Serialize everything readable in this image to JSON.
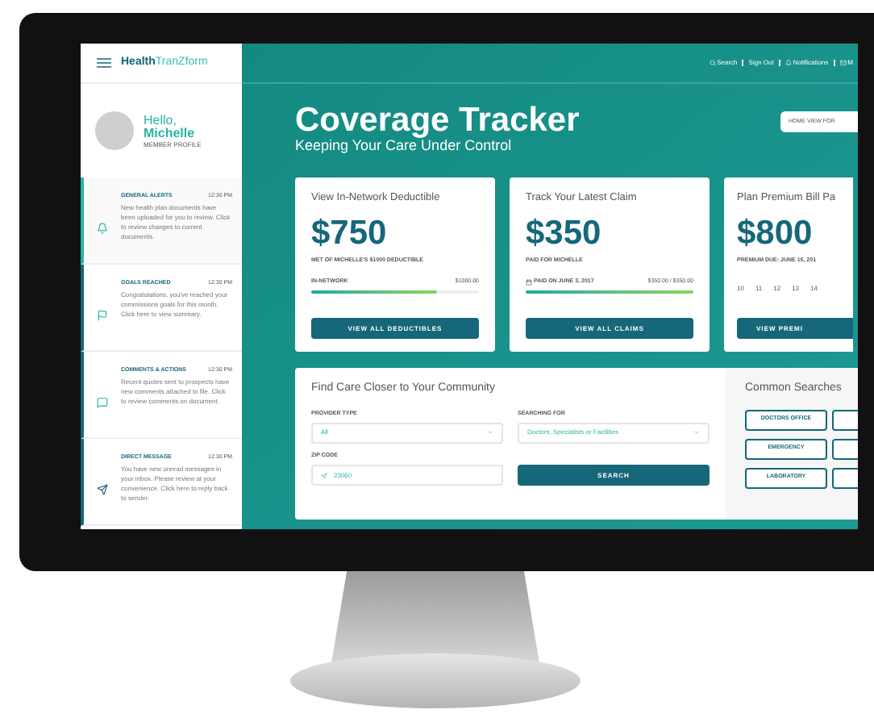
{
  "brand": {
    "part_1": "Health",
    "part_2": "TranZform"
  },
  "profile": {
    "greeting": "Hello,",
    "name": "Michelle",
    "caption": "MEMBER PROFILE"
  },
  "alerts": [
    {
      "kind": "bell",
      "title": "GENERAL ALERTS",
      "time": "12:30 PM",
      "text": "New health plan documents have been uploaded for you to review. Click to review changes to current documents.",
      "selected": true
    },
    {
      "kind": "flag",
      "title": "GOALS REACHED",
      "time": "12:30 PM",
      "text": "Congratulations, you've reached your commissions goals for this month. Click here to view summary.",
      "selected": false
    },
    {
      "kind": "chat",
      "title": "COMMENTS & ACTIONS",
      "time": "12:30 PM",
      "text": "Recent quotes sent to prospects have new comments attached to file. Click to review comments on document.",
      "selected": false
    },
    {
      "kind": "send",
      "title": "DIRECT MESSAGE",
      "time": "12:30 PM",
      "text": "You have new unread messages in your inbox. Please review at your convenience. Click here to reply back to sender.",
      "selected": false
    }
  ],
  "top_nav": [
    {
      "kind": "search",
      "label": "Search"
    },
    {
      "kind": "plain",
      "label": "Sign Out"
    },
    {
      "kind": "bell",
      "label": "Notifications"
    },
    {
      "kind": "mail",
      "label": "M"
    }
  ],
  "header": {
    "title": "Coverage Tracker",
    "subtitle": "Keeping Your Care Under Control",
    "view_select": "HOME VIEW FOR"
  },
  "cards": [
    {
      "kind": "progress",
      "title": "View In-Network Deductible",
      "amount": "$750",
      "caption": "MET OF MICHELLE'S $1000 DEDUCTIBLE",
      "left": "IN-NETWORK",
      "right": "$1000.00",
      "level": 0.75,
      "button": "VIEW ALL DEDUCTIBLES"
    },
    {
      "kind": "progress",
      "title": "Track Your Latest Claim",
      "amount": "$350",
      "caption": "PAID FOR MICHELLE",
      "left": "PAID ON JUNE 3, 2017",
      "right": "$350.00 / $350.00",
      "level": 1,
      "button": "VIEW ALL CLAIMS"
    },
    {
      "kind": "calendar",
      "title": "Plan Premium Bill Pa",
      "amount": "$800",
      "caption": "PREMIUM DUE: JUNE 15, 201",
      "days": [
        "10",
        "11",
        "12",
        "13",
        "14"
      ],
      "button": "VIEW PREMI"
    }
  ],
  "finder": {
    "title": "Find Care Closer to Your Community",
    "provider_label": "PROVIDER TYPE",
    "provider_value": "All",
    "searching_label": "SEARCHING FOR",
    "searching_value": "Doctors, Specialists or Facilities",
    "zip_label": "ZIP CODE",
    "zip_value": "23060",
    "search_button": "SEARCH"
  },
  "common_searches": {
    "title": "Common Searches",
    "buttons": [
      "DOCTORS OFFICE",
      "EMERGENCY",
      "LABORATORY"
    ]
  }
}
